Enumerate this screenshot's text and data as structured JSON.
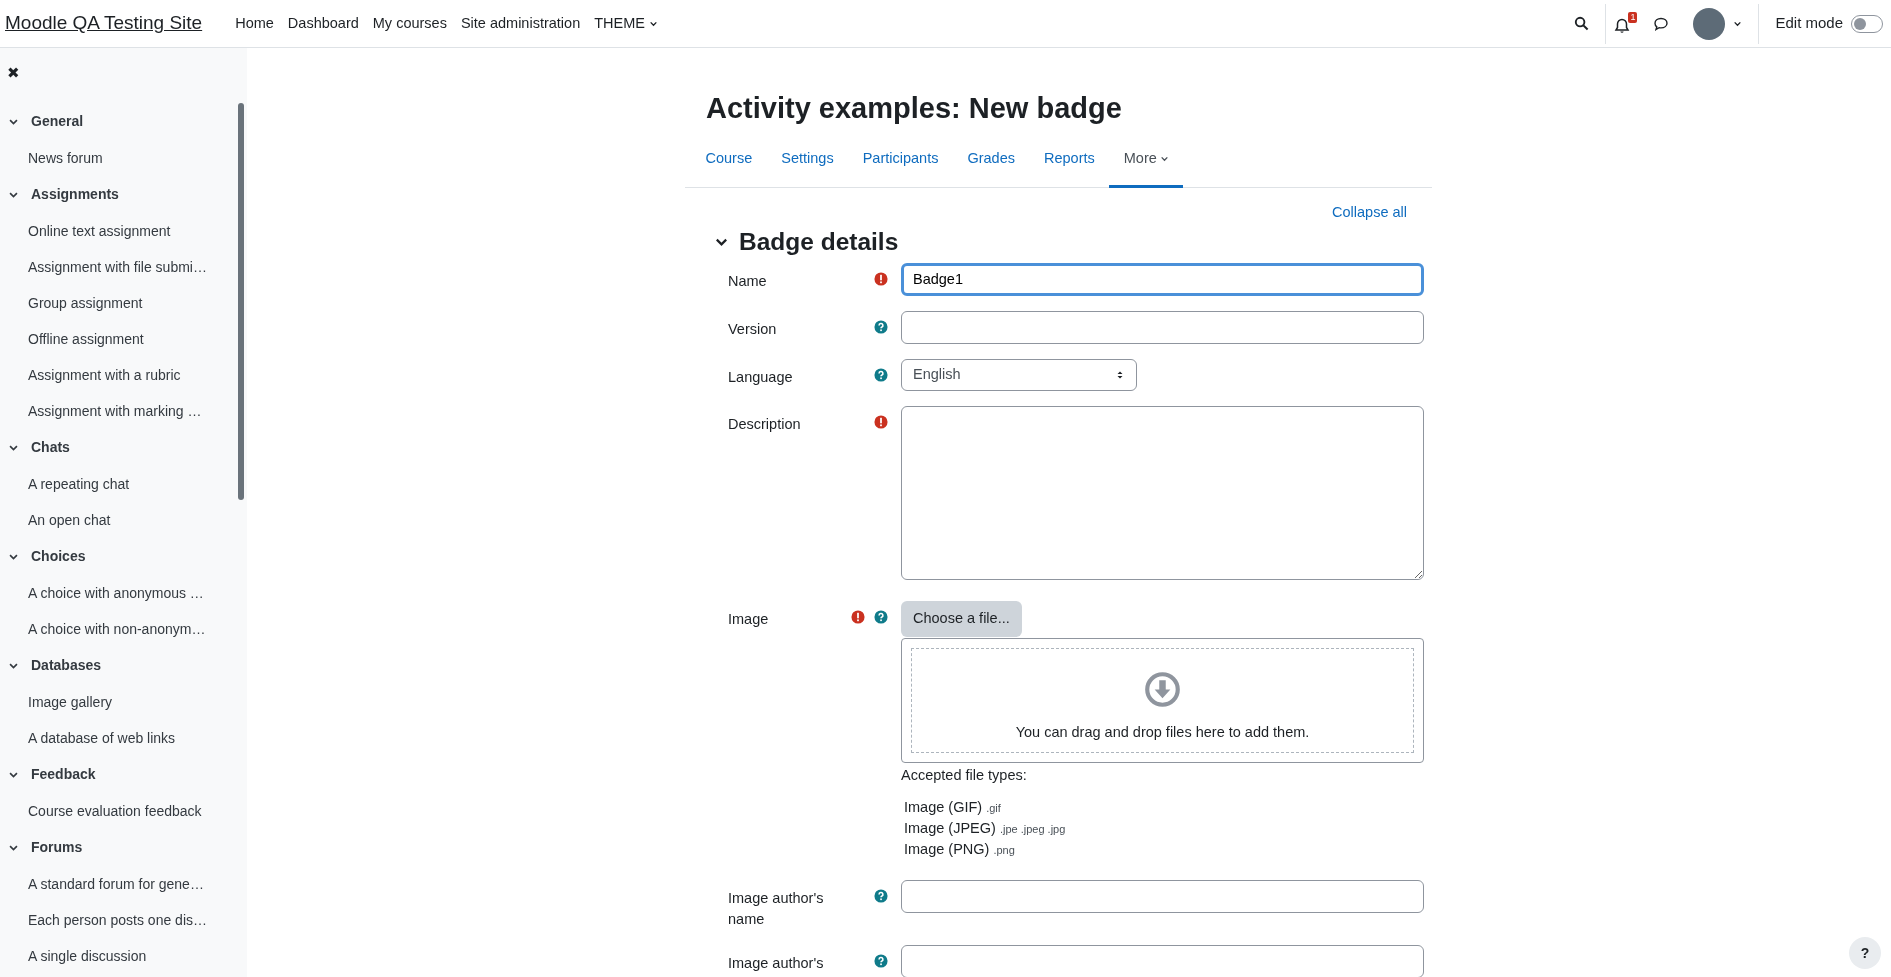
{
  "navbar": {
    "brand": "Moodle QA Testing Site",
    "links": [
      {
        "label": "Home",
        "dropdown": false
      },
      {
        "label": "Dashboard",
        "dropdown": false
      },
      {
        "label": "My courses",
        "dropdown": false
      },
      {
        "label": "Site administration",
        "dropdown": false
      },
      {
        "label": "THEME",
        "dropdown": true
      }
    ],
    "notification_count": "1",
    "edit_mode": {
      "label": "Edit mode",
      "on": false
    }
  },
  "sidebar": {
    "close": "✖",
    "sections": [
      {
        "title": "General",
        "expanded": true,
        "items": [
          "News forum"
        ]
      },
      {
        "title": "Assignments",
        "expanded": true,
        "items": [
          "Online text assignment",
          "Assignment with file submi…",
          "Group assignment",
          "Offline assignment",
          "Assignment with a rubric",
          "Assignment with marking …"
        ]
      },
      {
        "title": "Chats",
        "expanded": true,
        "items": [
          "A repeating chat",
          "An open chat"
        ]
      },
      {
        "title": "Choices",
        "expanded": true,
        "items": [
          "A choice with anonymous …",
          "A choice with non-anonym…"
        ]
      },
      {
        "title": "Databases",
        "expanded": true,
        "items": [
          "Image gallery",
          "A database of web links"
        ]
      },
      {
        "title": "Feedback",
        "expanded": true,
        "items": [
          "Course evaluation feedback"
        ]
      },
      {
        "title": "Forums",
        "expanded": true,
        "items": [
          "A standard forum for gene…",
          "Each person posts one dis…",
          "A single discussion"
        ]
      }
    ]
  },
  "page": {
    "title": "Activity examples: New badge",
    "tabs": [
      {
        "label": "Course",
        "selected": false,
        "dropdown": false
      },
      {
        "label": "Settings",
        "selected": false,
        "dropdown": false
      },
      {
        "label": "Participants",
        "selected": false,
        "dropdown": false
      },
      {
        "label": "Grades",
        "selected": false,
        "dropdown": false
      },
      {
        "label": "Reports",
        "selected": false,
        "dropdown": false
      },
      {
        "label": "More",
        "selected": true,
        "dropdown": true
      }
    ],
    "collapse_all": "Collapse all",
    "section": {
      "title": "Badge details",
      "expanded": true
    },
    "fields": [
      {
        "kind": "text",
        "label": "Name",
        "required": true,
        "help": false,
        "value": "Badge1",
        "focused": true
      },
      {
        "kind": "text",
        "label": "Version",
        "required": false,
        "help": true,
        "focused": false
      },
      {
        "kind": "select",
        "label": "Language",
        "required": false,
        "help": true,
        "value": "English",
        "focused": false
      },
      {
        "kind": "textarea",
        "label": "Description",
        "required": true,
        "help": false,
        "focused": false
      },
      {
        "kind": "file",
        "label": "Image",
        "required": true,
        "help": true,
        "focused": false,
        "button": "Choose a file...",
        "drop_text": "You can drag and drop files here to add them.",
        "accepted_label": "Accepted file types:",
        "types": [
          {
            "name": "Image (GIF)",
            "ext": ".gif"
          },
          {
            "name": "Image (JPEG)",
            "ext": ".jpe .jpeg .jpg"
          },
          {
            "name": "Image (PNG)",
            "ext": ".png"
          }
        ]
      },
      {
        "kind": "text",
        "label": "Image author's name",
        "required": false,
        "help": true,
        "focused": false
      },
      {
        "kind": "text",
        "label": "Image author's",
        "required": false,
        "help": true,
        "focused": false
      }
    ]
  },
  "help_button": "?"
}
